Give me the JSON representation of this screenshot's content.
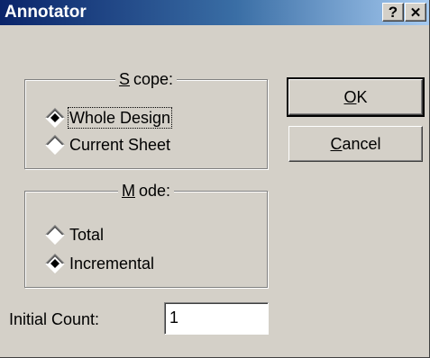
{
  "window": {
    "title": "Annotator",
    "help_label": "?",
    "close_label": "✕"
  },
  "scope": {
    "label_mnemonic": "S",
    "label_rest": "cope:",
    "options": [
      {
        "label": "Whole Design",
        "selected": true,
        "focused": true
      },
      {
        "label": "Current Sheet",
        "selected": false,
        "focused": false
      }
    ]
  },
  "mode": {
    "label_mnemonic": "M",
    "label_rest": "ode:",
    "options": [
      {
        "label": "Total",
        "selected": false
      },
      {
        "label": "Incremental",
        "selected": true
      }
    ]
  },
  "buttons": {
    "ok_mnemonic": "O",
    "ok_rest": "K",
    "cancel_mnemonic": "C",
    "cancel_rest": "ancel"
  },
  "initial_count": {
    "label": "Initial Count:",
    "value": "1"
  }
}
